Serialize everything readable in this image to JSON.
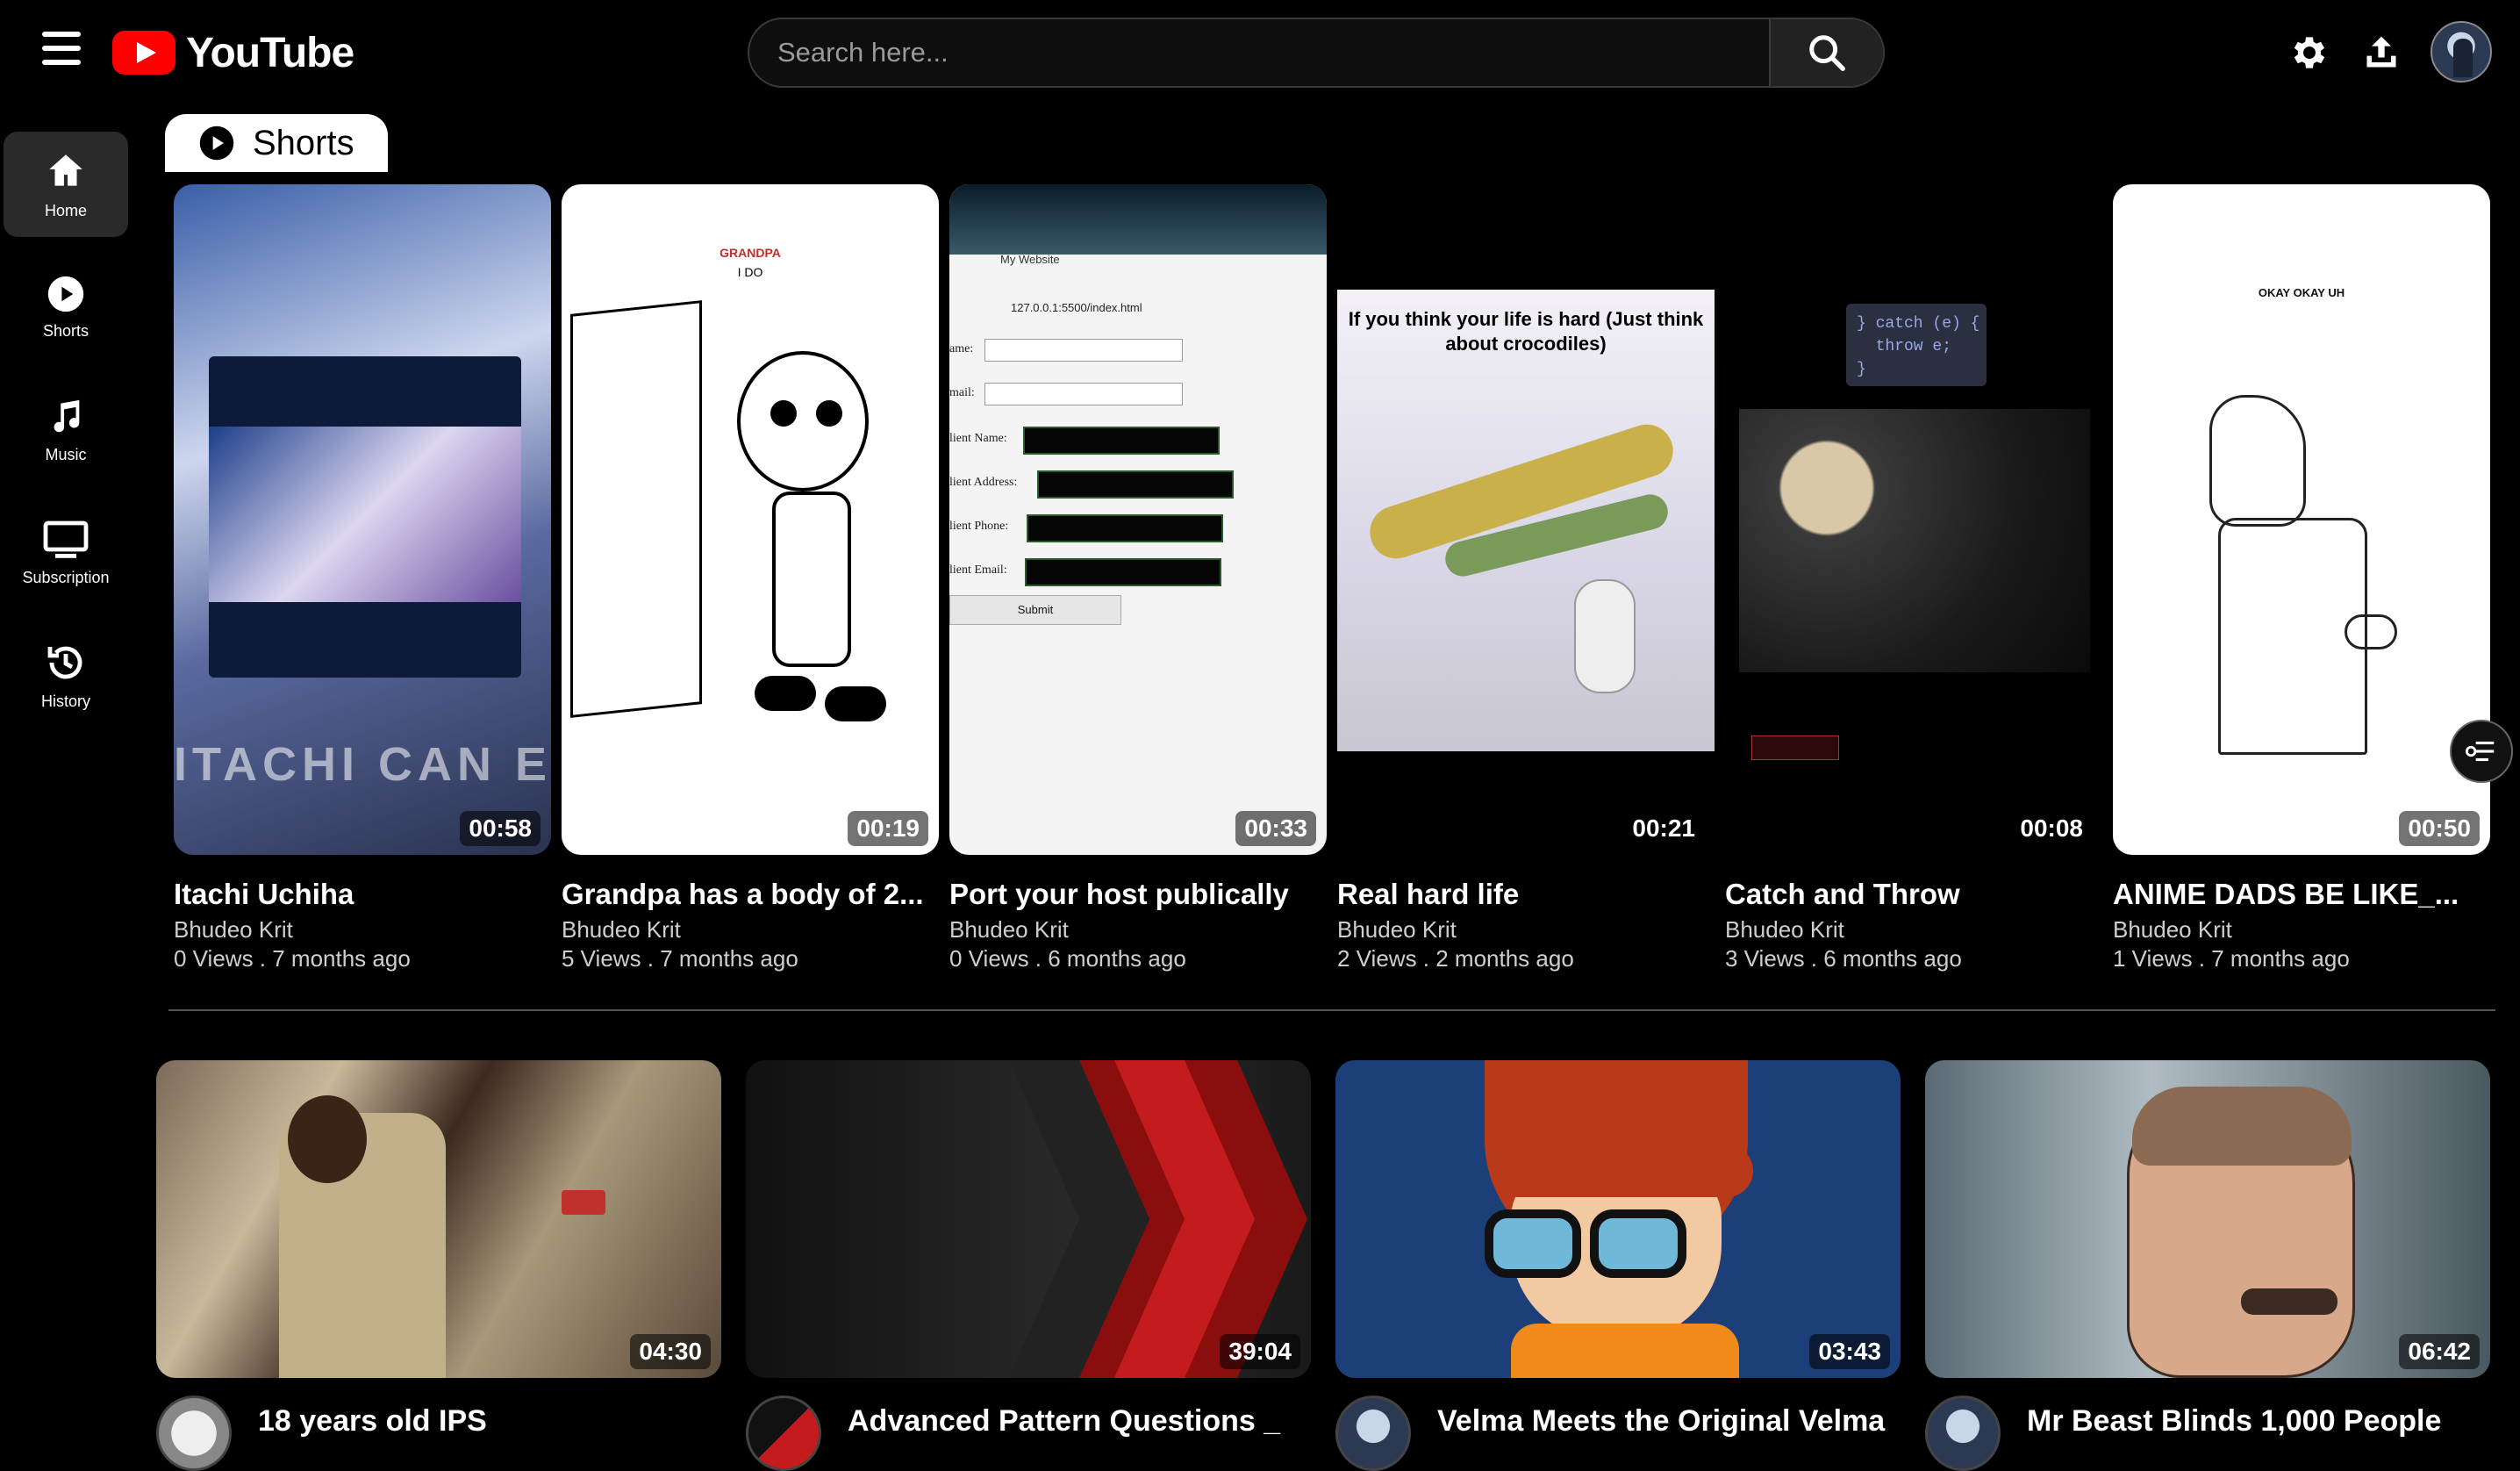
{
  "app": {
    "title": "YouTube"
  },
  "header": {
    "search_placeholder": "Search here...",
    "icons": [
      "menu-icon",
      "search-icon",
      "settings-icon",
      "upload-icon",
      "avatar"
    ]
  },
  "sidebar": {
    "items": [
      {
        "label": "Home",
        "icon": "home-icon",
        "active": true
      },
      {
        "label": "Shorts",
        "icon": "shorts-icon",
        "active": false
      },
      {
        "label": "Music",
        "icon": "music-icon",
        "active": false
      },
      {
        "label": "Subscription",
        "icon": "tv-icon",
        "active": false
      },
      {
        "label": "History",
        "icon": "history-icon",
        "active": false
      }
    ]
  },
  "shorts": {
    "tab_label": "Shorts",
    "items": [
      {
        "title": "Itachi Uchiha",
        "channel": "Bhudeo Krit",
        "meta": "0 Views . 7 months ago",
        "duration": "00:58"
      },
      {
        "title": "Grandpa has a body of 2...",
        "channel": "Bhudeo Krit",
        "meta": "5 Views . 7 months ago",
        "duration": "00:19"
      },
      {
        "title": "Port your host publically",
        "channel": "Bhudeo Krit",
        "meta": "0 Views . 6 months ago",
        "duration": "00:33"
      },
      {
        "title": "Real hard life",
        "channel": "Bhudeo Krit",
        "meta": "2 Views . 2 months ago",
        "duration": "00:21"
      },
      {
        "title": "Catch and Throw",
        "channel": "Bhudeo Krit",
        "meta": "3 Views . 6 months ago",
        "duration": "00:08"
      },
      {
        "title": "ANIME DADS BE LIKE_...",
        "channel": "Bhudeo Krit",
        "meta": "1 Views . 7 months ago",
        "duration": "00:50"
      }
    ],
    "thumb_text": {
      "itachi_banner": "ITACHI CAN EVE",
      "grandpa_caption": "GRANDPA",
      "grandpa_sub": "I DO",
      "crocodile_caption": "If you think your life is hard (Just think about crocodiles)",
      "code_snippet": "} catch (e) {\n  throw e;\n}",
      "anime_caption": "OKAY OKAY UH",
      "form_url": "127.0.0.1:5500/index.html",
      "form_tab": "My Website",
      "form_fields": [
        "ame:",
        "mail:",
        "lient Name:",
        "lient Address:",
        "lient Phone:",
        "lient Email:"
      ],
      "form_submit": "Submit"
    }
  },
  "videos": {
    "items": [
      {
        "title": "18 years old IPS",
        "duration": "04:30"
      },
      {
        "title": "Advanced Pattern Questions _",
        "duration": "39:04"
      },
      {
        "title": "Velma Meets the Original Velma",
        "duration": "03:43"
      },
      {
        "title": "Mr Beast Blinds 1,000 People",
        "duration": "06:42"
      }
    ]
  },
  "colors": {
    "brand": "#ff0000",
    "background": "#000000",
    "tab_bg": "#ffffff"
  }
}
